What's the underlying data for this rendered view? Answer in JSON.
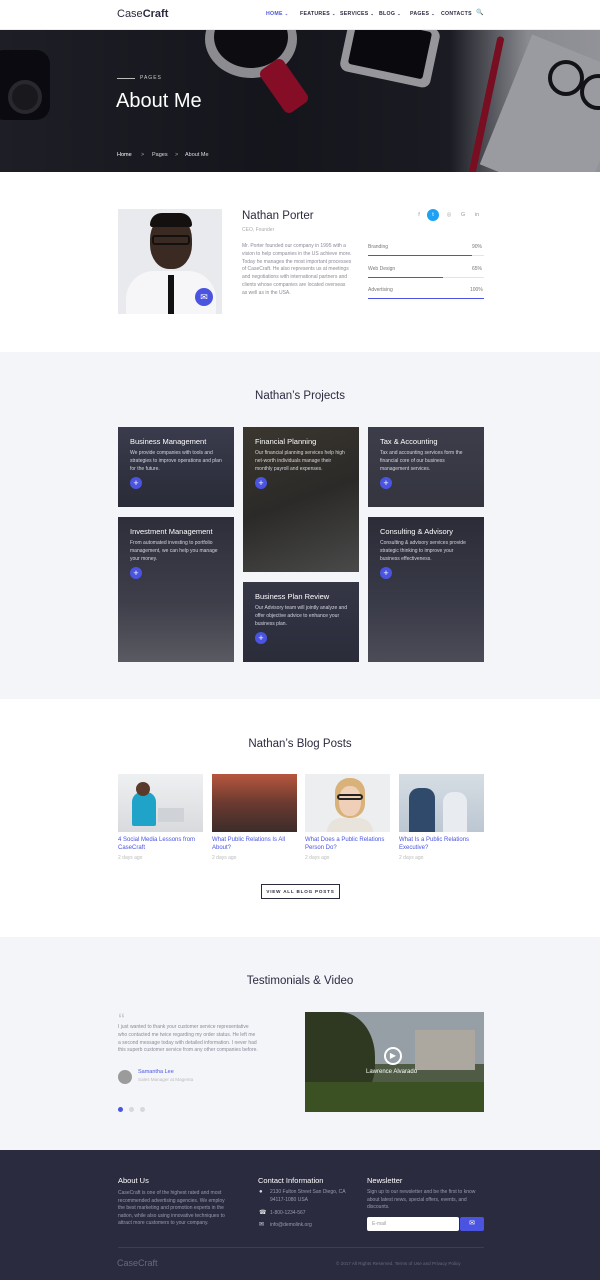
{
  "header": {
    "logo_a": "Case",
    "logo_b": "Craft",
    "nav": [
      {
        "label": "HOME",
        "caret": "⌄",
        "active": true
      },
      {
        "label": "FEATURES",
        "caret": "⌄"
      },
      {
        "label": "SERVICES",
        "caret": "⌄"
      },
      {
        "label": "BLOG",
        "caret": "⌄"
      },
      {
        "label": "PAGES",
        "caret": "⌄"
      },
      {
        "label": "CONTACTS",
        "caret": ""
      }
    ],
    "search_icon": "🔍"
  },
  "hero": {
    "kicker": "PAGES",
    "title": "About Me",
    "breadcrumb": [
      "Home",
      "Pages",
      "About Me"
    ],
    "sep": ">"
  },
  "profile": {
    "name": "Nathan Porter",
    "role": "CEO, Founder",
    "bio": "Mr. Porter founded our company in 1995 with a vision to help companies in the US achieve more. Today he manages the most important processes of CaseCraft. He also represents us at meetings and negotiations with international partners and clients whose companies are located overseas as well as in the USA.",
    "social": [
      "f",
      "t",
      "◎",
      "G",
      "in"
    ],
    "skills": [
      {
        "label": "Branding",
        "value": "90%",
        "level": 0.9
      },
      {
        "label": "Web Design",
        "value": "65%",
        "level": 0.65
      },
      {
        "label": "Advertising",
        "value": "100%",
        "level": 1.0
      }
    ]
  },
  "projects": {
    "title": "Nathan’s Projects",
    "plus": "+",
    "items": [
      {
        "title": "Business Management",
        "desc": "We provide companies with tools and strategies to improve operations and plan for the future."
      },
      {
        "title": "Financial Planning",
        "desc": "Our financial planning services help high net-worth individuals manage their monthly payroll and expenses."
      },
      {
        "title": "Tax & Accounting",
        "desc": "Tax and accounting services form the financial core of our business management services."
      },
      {
        "title": "Investment Management",
        "desc": "From automated investing to portfolio management, we can help you manage your money."
      },
      {
        "title": "Business Plan Review",
        "desc": "Our Advisory team will jointly analyze and offer objective advice to enhance your business plan."
      },
      {
        "title": "Consulting & Advisory",
        "desc": "Consulting & advisory services provide strategic thinking to improve your business effectiveness."
      }
    ]
  },
  "blog": {
    "title": "Nathan’s Blog Posts",
    "posts": [
      {
        "title": "4 Social Media Lessons from CaseCraft",
        "date": "2 days ago"
      },
      {
        "title": "What Public Relations Is All About?",
        "date": "2 days ago"
      },
      {
        "title": "What Does a Public Relations Person Do?",
        "date": "2 days ago"
      },
      {
        "title": "What Is a Public Relations Executive?",
        "date": "2 days ago"
      }
    ],
    "view_all": "VIEW ALL BLOG POSTS"
  },
  "testimonials": {
    "title": "Testimonials & Video",
    "quote_mark": "“",
    "text": "I just wanted to thank your customer service representative who contacted me twice regarding my order status. He left me a second message today with detailed information. I never had this superb customer service from any other companies before.",
    "author": "Samantha Lee",
    "author_role": "Sales Manager at Magenta",
    "video_name": "Lawrence Alvarado",
    "play": "▶"
  },
  "footer": {
    "about_title": "About Us",
    "about_text": "CaseCraft is one of the highest rated and most recommended advertising agencies. We employ the best marketing and promotion experts in the nation, while also using innovative techniques to attract more customers to your company.",
    "contact_title": "Contact Information",
    "address": "2130 Fulton Street San Diego, CA 94117-1080 USA",
    "phone": "1-800-1234-567",
    "email": "info@demolink.org",
    "newsletter_title": "Newsletter",
    "newsletter_text": "Sign up to our newsletter and be the first to know about latest news, special offers, events, and discounts.",
    "email_placeholder": "E-mail",
    "send_icon": "✉",
    "logo": "CaseCraft",
    "copyright": "© 2017 All Rights Reserved. Terms of Use and Privacy Policy"
  },
  "colors": {
    "accent": "#4a54e1",
    "dark": "#2b2b40",
    "light_bg": "#f4f5f9"
  }
}
